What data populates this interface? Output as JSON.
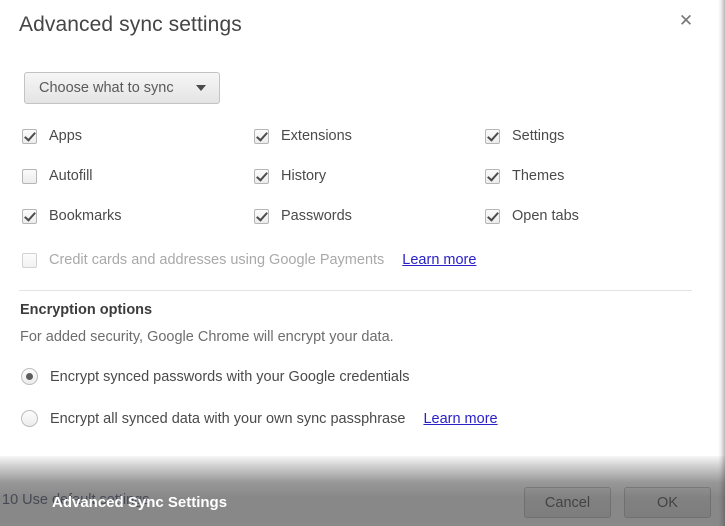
{
  "dialog": {
    "title": "Advanced sync settings",
    "close_icon": "close-icon",
    "dropdown": {
      "label": "Choose what to sync",
      "caret_icon": "chevron-down-icon"
    },
    "sync_items": [
      {
        "label": "Apps",
        "checked": true,
        "disabled": false,
        "column": 1,
        "row": 1
      },
      {
        "label": "Extensions",
        "checked": true,
        "disabled": false,
        "column": 2,
        "row": 1
      },
      {
        "label": "Settings",
        "checked": true,
        "disabled": false,
        "column": 3,
        "row": 1
      },
      {
        "label": "Autofill",
        "checked": false,
        "disabled": false,
        "column": 1,
        "row": 2
      },
      {
        "label": "History",
        "checked": true,
        "disabled": false,
        "column": 2,
        "row": 2
      },
      {
        "label": "Themes",
        "checked": true,
        "disabled": false,
        "column": 3,
        "row": 2
      },
      {
        "label": "Bookmarks",
        "checked": true,
        "disabled": false,
        "column": 1,
        "row": 3
      },
      {
        "label": "Passwords",
        "checked": true,
        "disabled": false,
        "column": 2,
        "row": 3
      },
      {
        "label": "Open tabs",
        "checked": true,
        "disabled": false,
        "column": 3,
        "row": 3
      }
    ],
    "credit_cards": {
      "label": "Credit cards and addresses using Google Payments",
      "link": "Learn more",
      "checked": false,
      "disabled": true
    },
    "encryption": {
      "heading": "Encryption options",
      "description": "For added security, Google Chrome will encrypt your data.",
      "options": [
        {
          "label": "Encrypt synced passwords with your Google credentials",
          "selected": true,
          "link": ""
        },
        {
          "label": "Encrypt all synced data with your own sync passphrase",
          "selected": false,
          "link": "Learn more"
        }
      ]
    },
    "footer": {
      "hint": "10 Use default settings",
      "cancel_label": "Cancel",
      "ok_label": "OK"
    }
  },
  "overlay": {
    "window_title": "Advanced Sync Settings"
  },
  "colors": {
    "link": "#2b21c7",
    "text": "#4a4a4a",
    "muted": "#a9a9a9",
    "overlay": "#3e3e3e"
  }
}
